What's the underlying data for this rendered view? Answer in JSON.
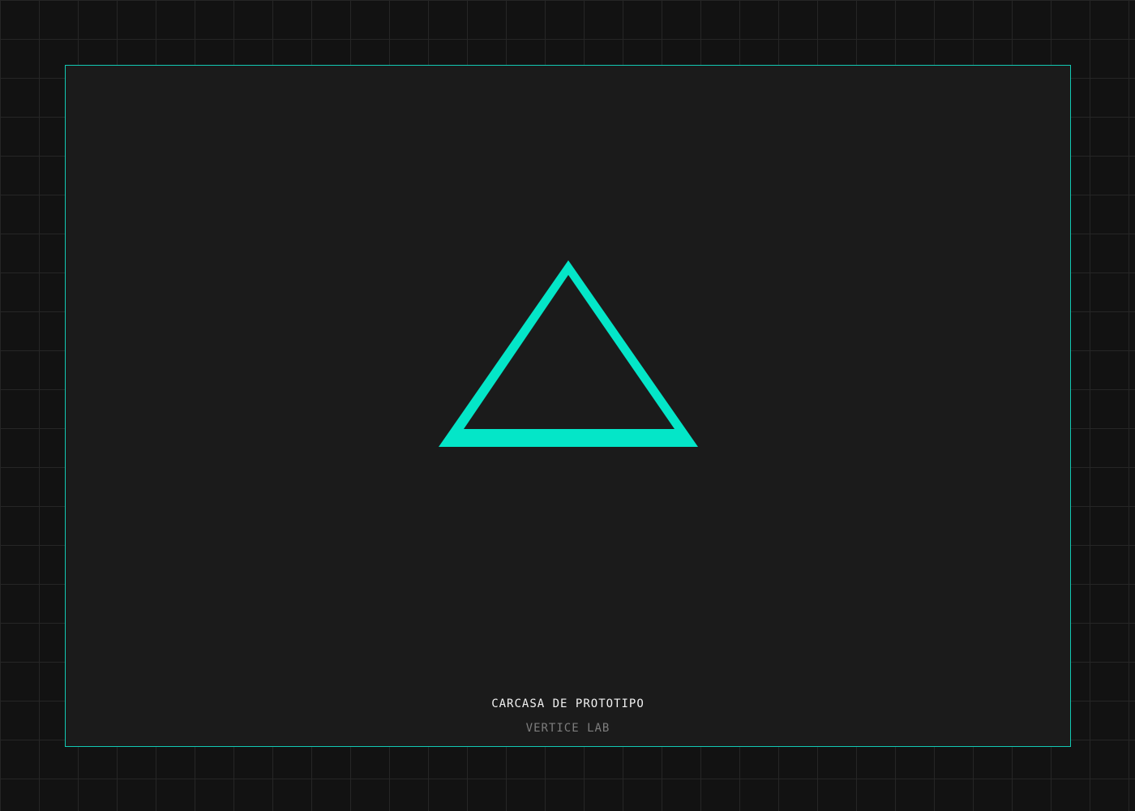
{
  "caption": {
    "title": "CARCASA DE PROTOTIPO",
    "subtitle": "VERTICE LAB"
  },
  "logo": {
    "icon": "triangle-outline-icon",
    "color": "#04e6c8"
  },
  "colors": {
    "background": "#121212",
    "grid_line": "#262626",
    "panel": "#1b1b1b",
    "frame_border": "#12c9b3",
    "accent": "#04e6c8",
    "title_text": "#f2f2f2",
    "subtitle_text": "#7e7e7e"
  }
}
